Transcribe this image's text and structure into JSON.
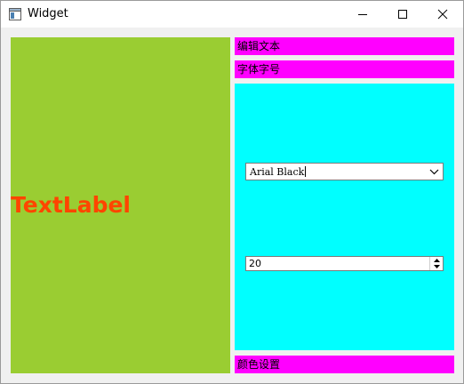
{
  "window": {
    "title": "Widget",
    "icon": "window-app-icon",
    "controls": {
      "minimize_icon": "minimize-icon",
      "maximize_icon": "maximize-icon",
      "close_icon": "close-icon"
    }
  },
  "left_panel": {
    "label_text": "TextLabel",
    "background": "#9acd32",
    "label_color": "#ff4500"
  },
  "right_panel": {
    "edit_text_button": "编辑文本",
    "font_size_button": "字体字号",
    "color_settings_button": "颜色设置",
    "button_color": "#ff00ff",
    "font_panel_color": "#00ffff",
    "font_combo": {
      "value": "Arial Black",
      "arrow_icon": "chevron-down-icon"
    },
    "size_spinbox": {
      "value": "20",
      "up_icon": "spin-up-icon",
      "down_icon": "spin-down-icon"
    }
  }
}
